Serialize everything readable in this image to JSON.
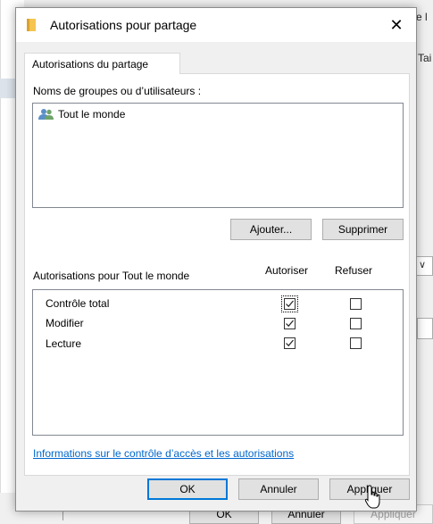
{
  "background": {
    "right_text_top": "e l",
    "right_text_mid": "Tai",
    "dropdown_glyph": "∨",
    "bottom_buttons": {
      "ok": "OK",
      "cancel": "Annuler",
      "apply": "Appliquer"
    }
  },
  "dialog": {
    "title": "Autorisations pour partage",
    "close_glyph": "✕",
    "tab_label": "Autorisations du partage",
    "groups_label": "Noms de groupes ou d’utilisateurs :",
    "groups": [
      {
        "name": "Tout le monde",
        "icon": "users-icon"
      }
    ],
    "add_button": "Ajouter...",
    "remove_button": "Supprimer",
    "permissions_for": "Autorisations pour Tout le monde",
    "col_allow": "Autoriser",
    "col_deny": "Refuser",
    "permissions": [
      {
        "name": "Contrôle total",
        "allow": true,
        "deny": false
      },
      {
        "name": "Modifier",
        "allow": true,
        "deny": false
      },
      {
        "name": "Lecture",
        "allow": true,
        "deny": false
      }
    ],
    "info_link": "Informations sur le contrôle d’accès et les autorisations",
    "ok_button": "OK",
    "cancel_button": "Annuler",
    "apply_button": "Appliquer"
  },
  "colors": {
    "link": "#0066cc",
    "default_button_border": "#0078d7",
    "dialog_bg": "#f0f0f0",
    "panel_bg": "#ffffff"
  }
}
